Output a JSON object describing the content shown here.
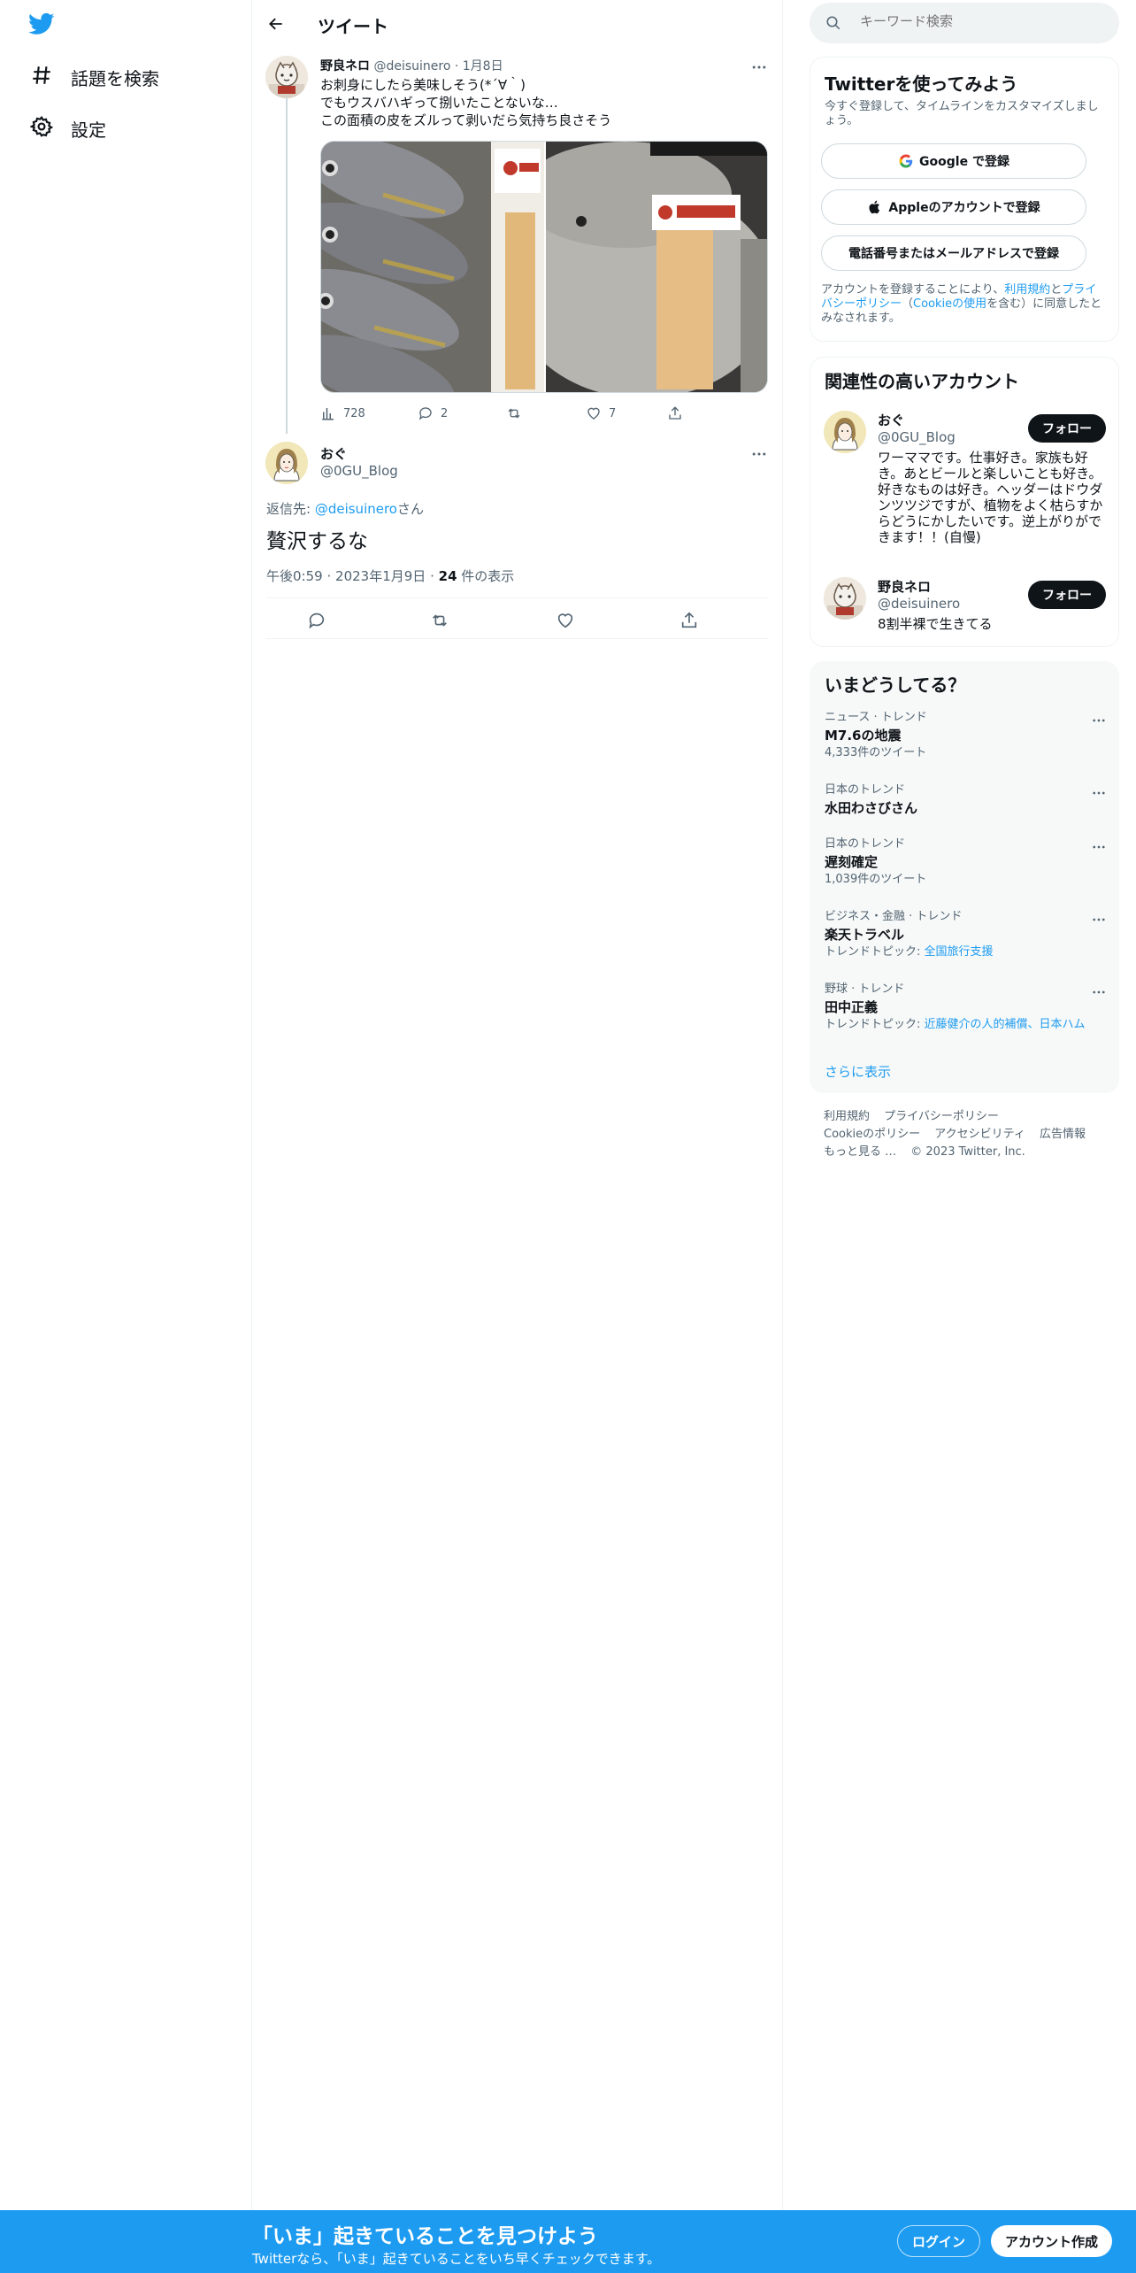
{
  "nav": {
    "items": [
      {
        "label": "話題を検索",
        "icon": "hashtag-icon"
      },
      {
        "label": "設定",
        "icon": "gear-icon"
      }
    ]
  },
  "header": {
    "title": "ツイート"
  },
  "tweet1": {
    "name": "野良ネロ",
    "handle": "@deisuinero",
    "sep": "·",
    "date": "1月8日",
    "lines": [
      "お刺身にしたら美味しそう(*´∀｀)",
      "でもウスバハギって捌いたことないな…",
      "この面積の皮をズルって剥いだら気持ち良さそう"
    ],
    "views": "728",
    "replies": "2",
    "retweets": "",
    "likes": "7",
    "photo1": {
      "tag_text": "いさき",
      "price": "5"
    },
    "photo2": {
      "tag_text": "うすばはぎ",
      "price": "1780"
    }
  },
  "tweet2": {
    "name": "おぐ",
    "handle": "@0GU_Blog",
    "reply_prefix": "返信先: ",
    "reply_to": "@deisuinero",
    "reply_suffix": "さん",
    "text": "贅沢するな",
    "time": "午後0:59",
    "date": "2023年1月9日",
    "dot": "·",
    "views_count": "24",
    "views_label": " 件の表示"
  },
  "search": {
    "placeholder": "キーワード検索"
  },
  "signup_card": {
    "title": "Twitterを使ってみよう",
    "subtitle": "今すぐ登録して、タイムラインをカスタマイズしましょう。",
    "google": "Google で登録",
    "apple": "Appleのアカウントで登録",
    "phone": "電話番号またはメールアドレスで登録",
    "legal_1": "アカウントを登録することにより、",
    "legal_terms": "利用規約",
    "legal_2": "と",
    "legal_privacy": "プライバシーポリシー",
    "legal_3": "（",
    "legal_cookie": "Cookieの使用",
    "legal_4": "を含む）に同意したとみなされます。"
  },
  "related": {
    "title": "関連性の高いアカウント",
    "accounts": [
      {
        "name": "おぐ",
        "handle": "@0GU_Blog",
        "follow": "フォロー",
        "bio": "ワーママです。仕事好き。家族も好き。あとビールと楽しいことも好き。好きなものは好き。ヘッダーはドウダンツツジですが、植物をよく枯らすからどうにかしたいです。逆上がりができます！！(自慢)"
      },
      {
        "name": "野良ネロ",
        "handle": "@deisuinero",
        "follow": "フォロー",
        "bio": "8割半裸で生きてる"
      }
    ]
  },
  "trends": {
    "title": "いまどうしてる？",
    "items": [
      {
        "context": "ニュース · トレンド",
        "name": "M7.6の地震",
        "count": "4,333件のツイート"
      },
      {
        "context": "日本のトレンド",
        "name": "水田わさびさん",
        "count": ""
      },
      {
        "context": "日本のトレンド",
        "name": "遅刻確定",
        "count": "1,039件のツイート"
      },
      {
        "context": "ビジネス・金融 · トレンド",
        "name": "楽天トラベル",
        "count_prefix": "トレンドトピック: ",
        "count_link": "全国旅行支援"
      },
      {
        "context": "野球 · トレンド",
        "name": "田中正義",
        "count_prefix": "トレンドトピック: ",
        "count_link": "近藤健介の人的補償、日本ハム"
      }
    ],
    "show_more": "さらに表示"
  },
  "footer": {
    "terms": "利用規約",
    "privacy": "プライバシーポリシー",
    "cookie": "Cookieのポリシー",
    "accessibility": "アクセシビリティ",
    "ads": "広告情報",
    "more": "もっと見る …",
    "copyright": "© 2023 Twitter, Inc."
  },
  "bottom_bar": {
    "title": "「いま」起きていることを見つけよう",
    "subtitle": "Twitterなら、「いま」起きていることをいち早くチェックできます。",
    "login": "ログイン",
    "signup": "アカウント作成"
  },
  "colors": {
    "accent": "#1d9bf0",
    "text": "#0f1419",
    "muted": "#536471",
    "border": "#eff3f4"
  }
}
